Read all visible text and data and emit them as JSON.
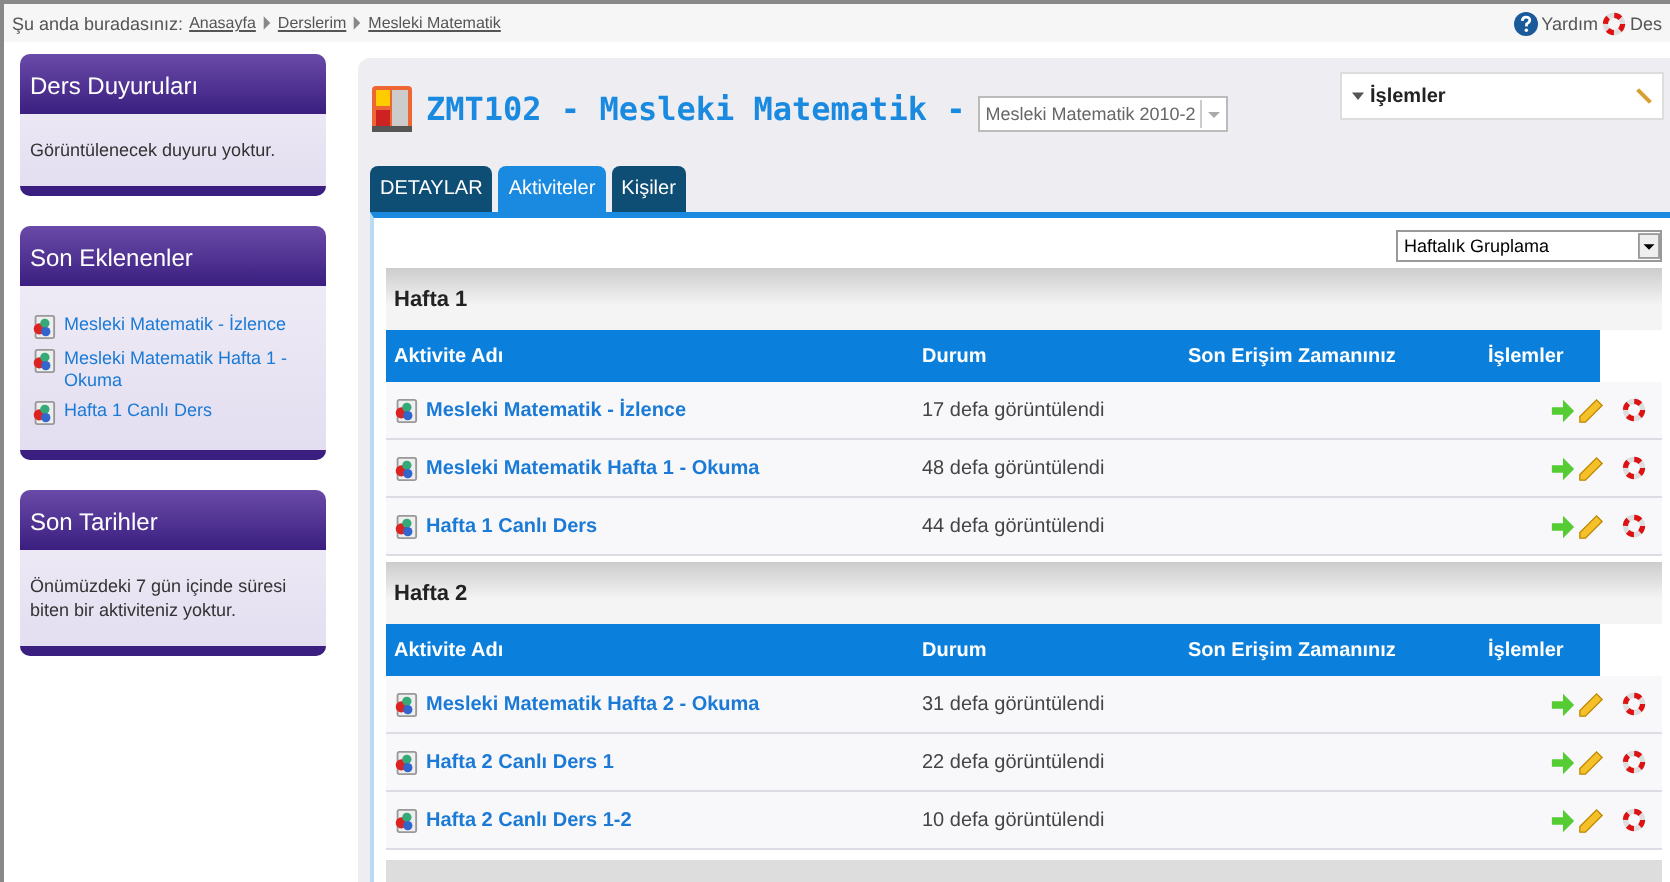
{
  "breadcrumb": {
    "label": "Şu anda buradasınız:",
    "links": [
      "Anasayfa",
      "Derslerim",
      "Mesleki Matematik"
    ]
  },
  "top_links": [
    {
      "kind": "help",
      "label": "Yardım"
    },
    {
      "kind": "lifebuoy",
      "label": "Des"
    }
  ],
  "sidebar": {
    "panels": [
      {
        "title": "Ders Duyuruları",
        "text": "Görüntülenecek duyuru yoktur."
      },
      {
        "title": "Son Eklenenler",
        "items": [
          "Mesleki Matematik - İzlence",
          "Mesleki Matematik Hafta 1 - Okuma",
          "Hafta 1 Canlı Ders"
        ]
      },
      {
        "title": "Son Tarihler",
        "text": "Önümüzdeki 7 gün içinde süresi biten bir aktiviteniz yoktur."
      }
    ]
  },
  "course": {
    "title": "ZMT102 - Mesleki Matematik -",
    "term_select": "Mesleki Matematik 2010-2",
    "actions_menu": "İşlemler"
  },
  "tabs": [
    {
      "label": "DETAYLAR",
      "selected": false
    },
    {
      "label": "Aktiviteler",
      "selected": true
    },
    {
      "label": "Kişiler",
      "selected": false
    }
  ],
  "grouping_select": "Haftalık Gruplama",
  "weeks": [
    {
      "title": "Hafta 1",
      "columns": [
        "Aktivite Adı",
        "Durum",
        "Son Erişim Zamanınız",
        "İşlemler"
      ],
      "rows": [
        {
          "name": "Mesleki Matematik - İzlence",
          "status": "17 defa görüntülendi"
        },
        {
          "name": "Mesleki Matematik Hafta 1 - Okuma",
          "status": "48 defa görüntülendi"
        },
        {
          "name": "Hafta 1 Canlı Ders",
          "status": "44 defa görüntülendi"
        }
      ]
    },
    {
      "title": "Hafta 2",
      "columns": [
        "Aktivite Adı",
        "Durum",
        "Son Erişim Zamanınız",
        "İşlemler"
      ],
      "rows": [
        {
          "name": "Mesleki Matematik Hafta 2 - Okuma",
          "status": "31 defa görüntülendi"
        },
        {
          "name": "Hafta 2 Canlı Ders 1",
          "status": "22 defa görüntülendi"
        },
        {
          "name": "Hafta 2 Canlı Ders 1-2",
          "status": "10 defa görüntülendi"
        }
      ]
    }
  ]
}
